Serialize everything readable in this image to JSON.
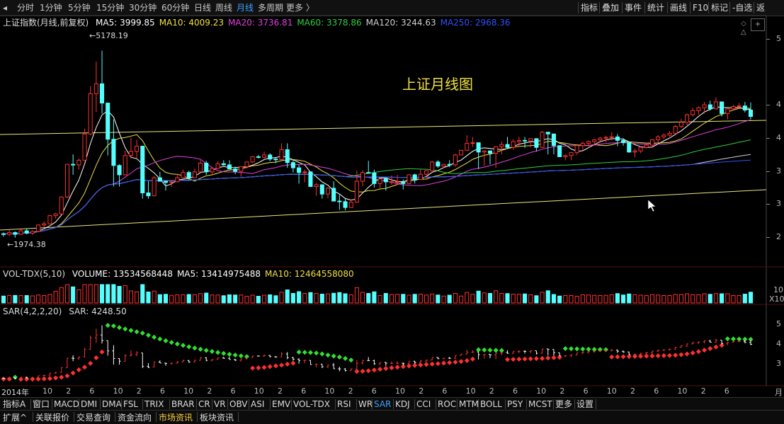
{
  "toolbar": {
    "periods": [
      "分时",
      "1分钟",
      "5分钟",
      "15分钟",
      "30分钟",
      "60分钟",
      "日线",
      "周线",
      "月线",
      "多周期",
      "更多 〉"
    ],
    "active_period": "月线",
    "right_items": [
      "指标",
      "叠加",
      "事件",
      "统计",
      "画线",
      "F10",
      "标记",
      "-自选",
      "返"
    ]
  },
  "main_pane": {
    "title": "上证指数(月线,前复权)",
    "ma": [
      {
        "label": "MA5: 3999.85",
        "color": "#ffffff"
      },
      {
        "label": "MA10: 4009.23",
        "color": "#f0e040"
      },
      {
        "label": "MA20: 3736.81",
        "color": "#e040e0"
      },
      {
        "label": "MA60: 3378.86",
        "color": "#30d040"
      },
      {
        "label": "MA120: 3244.63",
        "color": "#d0d0d0"
      },
      {
        "label": "MA250: 2968.36",
        "color": "#3050ff"
      }
    ],
    "chart_title": "上证月线图",
    "high_label": "5178.19",
    "low_label": "1974.38",
    "right_ticks": [
      "5",
      "4",
      "4",
      "3",
      "3",
      "2",
      "2"
    ]
  },
  "volume_pane": {
    "name": "VOL-TDX(5,10)",
    "items": [
      {
        "label": "VOLUME: 13534568448",
        "color": "#ffffff"
      },
      {
        "label": "MA5: 13414975488",
        "color": "#ffffff"
      },
      {
        "label": "MA10: 12464558080",
        "color": "#f0e040"
      }
    ],
    "right_ticks": [
      "10",
      "X10"
    ]
  },
  "sar_pane": {
    "name": "SAR(4,2,2,20)",
    "value_label": "SAR: 4248.50",
    "right_ticks": [
      "5",
      "4",
      "3"
    ]
  },
  "time_axis": {
    "labels": [
      "2014年",
      "10",
      "2",
      "6",
      "10",
      "2",
      "6",
      "10",
      "2",
      "6",
      "10",
      "2",
      "6",
      "10",
      "2",
      "6",
      "10",
      "2",
      "6",
      "10",
      "2",
      "6",
      "10",
      "2",
      "6",
      "10",
      "2",
      "6",
      "10",
      "2",
      "6",
      "月"
    ]
  },
  "indicator_tabs": [
    "指标A",
    "窗口",
    "MACD",
    "DMI",
    "DMA",
    "FSL",
    "TRIX",
    "BRAR",
    "CR",
    "VR",
    "OBV",
    "ASI",
    "EMV",
    "VOL-TDX",
    "RSI",
    "WR",
    "SAR",
    "KDJ",
    "CCI",
    "ROC",
    "MTM",
    "BOLL",
    "PSY",
    "MCST",
    "更多",
    "设置"
  ],
  "active_indicator": "SAR",
  "info_tabs": [
    "扩展^",
    "关联报价",
    "交易查询",
    "资金流向",
    "市场资讯",
    "板块资讯"
  ],
  "active_info_tab": "市场资讯",
  "chart_data": {
    "type": "candlestick",
    "title": "上证月线图",
    "series_name": "上证指数(月线,前复权)",
    "start": "2014-01",
    "frequency": "monthly",
    "candles": [
      [
        2040,
        2060,
        1990,
        2030
      ],
      [
        2030,
        2100,
        2000,
        2060
      ],
      [
        2060,
        2080,
        1974,
        2030
      ],
      [
        2030,
        2120,
        2020,
        2090
      ],
      [
        2090,
        2130,
        2030,
        2050
      ],
      [
        2050,
        2100,
        2020,
        2080
      ],
      [
        2080,
        2200,
        2070,
        2190
      ],
      [
        2190,
        2250,
        2150,
        2210
      ],
      [
        2210,
        2360,
        2200,
        2350
      ],
      [
        2350,
        2400,
        2300,
        2380
      ],
      [
        2380,
        2680,
        2370,
        2670
      ],
      [
        2670,
        3240,
        2650,
        3230
      ],
      [
        3230,
        3400,
        3050,
        3220
      ],
      [
        3220,
        3330,
        3140,
        3300
      ],
      [
        3300,
        3840,
        3290,
        3750
      ],
      [
        3750,
        4570,
        3730,
        4440
      ],
      [
        4440,
        4990,
        4130,
        4610
      ],
      [
        4610,
        5178,
        4100,
        4280
      ],
      [
        4280,
        4180,
        3380,
        3660
      ],
      [
        3660,
        4000,
        2850,
        3210
      ],
      [
        3210,
        3230,
        2850,
        3050
      ],
      [
        3050,
        3460,
        3040,
        3380
      ],
      [
        3380,
        3690,
        3330,
        3450
      ],
      [
        3450,
        3650,
        3340,
        3540
      ],
      [
        3540,
        3550,
        2640,
        2740
      ],
      [
        2740,
        2940,
        2640,
        2690
      ],
      [
        2690,
        3030,
        2680,
        3000
      ],
      [
        3000,
        3100,
        2950,
        2940
      ],
      [
        2940,
        2950,
        2780,
        2920
      ],
      [
        2920,
        2950,
        2840,
        2930
      ],
      [
        2930,
        3060,
        2920,
        3000
      ],
      [
        3000,
        3140,
        3000,
        3090
      ],
      [
        3090,
        3120,
        2960,
        3000
      ],
      [
        3000,
        3150,
        3000,
        3100
      ],
      [
        3100,
        3300,
        3090,
        3250
      ],
      [
        3250,
        3290,
        3050,
        3100
      ],
      [
        3100,
        3170,
        3040,
        3160
      ],
      [
        3160,
        3280,
        3150,
        3240
      ],
      [
        3240,
        3300,
        3210,
        3220
      ],
      [
        3220,
        3300,
        3160,
        3150
      ],
      [
        3150,
        3190,
        3060,
        3110
      ],
      [
        3110,
        3150,
        3020,
        3190
      ],
      [
        3190,
        3220,
        3160,
        3270
      ],
      [
        3270,
        3370,
        3250,
        3360
      ],
      [
        3360,
        3390,
        3330,
        3350
      ],
      [
        3350,
        3450,
        3330,
        3390
      ],
      [
        3390,
        3420,
        3280,
        3320
      ],
      [
        3320,
        3340,
        3250,
        3310
      ],
      [
        3310,
        3590,
        3300,
        3480
      ],
      [
        3480,
        3590,
        3170,
        3260
      ],
      [
        3260,
        3310,
        3090,
        3170
      ],
      [
        3170,
        3220,
        2900,
        3090
      ],
      [
        3090,
        3140,
        2920,
        3100
      ],
      [
        3100,
        3110,
        2840,
        2850
      ],
      [
        2850,
        2910,
        2690,
        2880
      ],
      [
        2880,
        2820,
        2640,
        2720
      ],
      [
        2720,
        2840,
        2650,
        2820
      ],
      [
        2820,
        2940,
        2710,
        2600
      ],
      [
        2600,
        2720,
        2450,
        2590
      ],
      [
        2590,
        2640,
        2440,
        2490
      ],
      [
        2490,
        2630,
        2490,
        2580
      ],
      [
        2580,
        3120,
        2580,
        2940
      ],
      [
        2940,
        3130,
        2850,
        3090
      ],
      [
        3090,
        3290,
        3070,
        3080
      ],
      [
        3080,
        3140,
        2830,
        2900
      ],
      [
        2900,
        2920,
        2820,
        2980
      ],
      [
        2980,
        3000,
        2780,
        2930
      ],
      [
        2930,
        3040,
        2880,
        2930
      ],
      [
        2930,
        3050,
        2880,
        2930
      ],
      [
        2930,
        2970,
        2800,
        2900
      ],
      [
        2900,
        3010,
        2890,
        3050
      ],
      [
        3050,
        3070,
        2900,
        2970
      ],
      [
        2970,
        3140,
        2960,
        3060
      ],
      [
        3060,
        3130,
        3000,
        3120
      ],
      [
        3120,
        3290,
        3100,
        3270
      ],
      [
        3270,
        3300,
        3170,
        3200
      ],
      [
        3200,
        3230,
        3160,
        3230
      ],
      [
        3230,
        3300,
        3180,
        3220
      ],
      [
        3220,
        3410,
        3190,
        3390
      ],
      [
        3390,
        3470,
        3400,
        3470
      ],
      [
        3470,
        3730,
        3460,
        3590
      ],
      [
        3590,
        3700,
        3530,
        3600
      ],
      [
        3600,
        3500,
        3150,
        3440
      ],
      [
        3440,
        3450,
        3200,
        3460
      ],
      [
        3460,
        3450,
        3230,
        3420
      ],
      [
        3420,
        3540,
        3170,
        3530
      ],
      [
        3530,
        3620,
        3400,
        3570
      ],
      [
        3570,
        3700,
        3490,
        3520
      ],
      [
        3520,
        3660,
        3480,
        3620
      ],
      [
        3620,
        3700,
        3530,
        3640
      ],
      [
        3640,
        3700,
        3510,
        3630
      ],
      [
        3630,
        3660,
        3520,
        3670
      ],
      [
        3670,
        3540,
        3450,
        3520
      ],
      [
        3520,
        3800,
        3510,
        3780
      ],
      [
        3780,
        3770,
        3400,
        3750
      ],
      [
        3750,
        3560,
        3400,
        3550
      ],
      [
        3550,
        3400,
        3470,
        3360
      ],
      [
        3360,
        3400,
        3300,
        3380
      ],
      [
        3380,
        3400,
        3300,
        3430
      ],
      [
        3430,
        3450,
        3390,
        3550
      ],
      [
        3550,
        3620,
        3480,
        3590
      ],
      [
        3590,
        3640,
        3510,
        3620
      ],
      [
        3620,
        3660,
        3550,
        3650
      ],
      [
        3650,
        3700,
        3600,
        3680
      ],
      [
        3680,
        3720,
        3610,
        3690
      ],
      [
        3690,
        3780,
        3640,
        3700
      ],
      [
        3700,
        3750,
        3540,
        3640
      ],
      [
        3640,
        3680,
        3550,
        3600
      ],
      [
        3600,
        3620,
        3430,
        3440
      ],
      [
        3440,
        3500,
        3350,
        3460
      ],
      [
        3460,
        3540,
        3420,
        3520
      ],
      [
        3520,
        3600,
        3500,
        3560
      ],
      [
        3560,
        3660,
        3510,
        3650
      ],
      [
        3650,
        3730,
        3600,
        3700
      ],
      [
        3700,
        3760,
        3660,
        3730
      ],
      [
        3730,
        3800,
        3700,
        3760
      ],
      [
        3760,
        3900,
        3740,
        3880
      ],
      [
        3880,
        4010,
        3850,
        3950
      ],
      [
        3950,
        4100,
        3900,
        4080
      ],
      [
        4080,
        4200,
        4050,
        4150
      ],
      [
        4150,
        4220,
        4080,
        4200
      ],
      [
        4200,
        4300,
        4100,
        4250
      ],
      [
        4250,
        4320,
        4150,
        4180
      ],
      [
        4180,
        4380,
        4170,
        4300
      ],
      [
        4300,
        4250,
        4050,
        4100
      ],
      [
        4100,
        4200,
        4000,
        4180
      ],
      [
        4180,
        4250,
        4150,
        4220
      ],
      [
        4220,
        4280,
        4180,
        4230
      ],
      [
        4230,
        4300,
        4120,
        4160
      ],
      [
        4160,
        4290,
        4000,
        4050
      ]
    ],
    "high_point": 5178.19,
    "low_point": 1974.38,
    "ylim": [
      1800,
      5500
    ]
  }
}
